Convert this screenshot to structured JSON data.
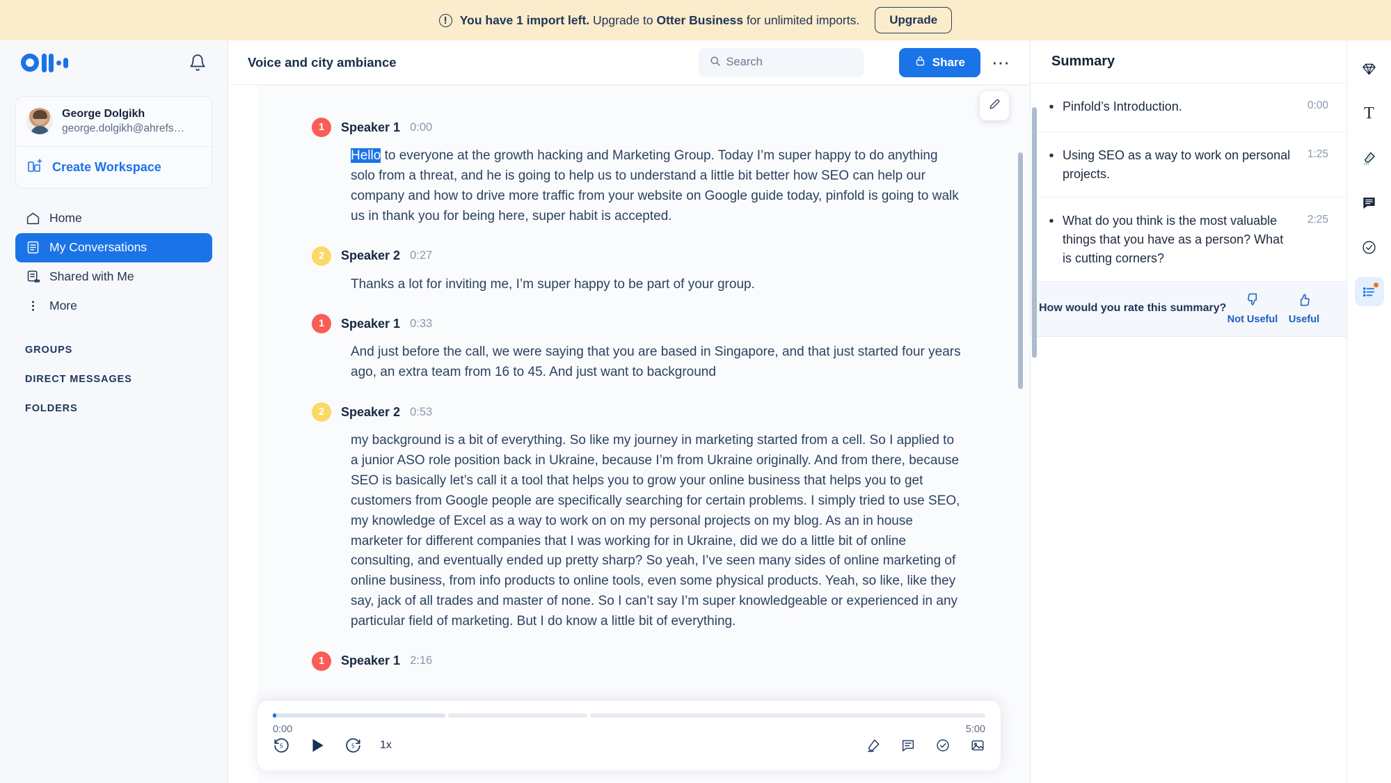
{
  "banner": {
    "icon": "alert-circle-icon",
    "text_before": "You have 1 import left.",
    "text_mid": " Upgrade to ",
    "brand": "Otter Business",
    "text_after": " for unlimited imports.",
    "upgrade_label": "Upgrade"
  },
  "sidebar": {
    "logo": "otter-logo",
    "notification_icon": "bell-icon",
    "user": {
      "name": "George Dolgikh",
      "email": "george.dolgikh@ahrefs…"
    },
    "create_workspace_label": "Create Workspace",
    "nav": [
      {
        "label": "Home",
        "icon": "home-icon",
        "active": false
      },
      {
        "label": "My Conversations",
        "icon": "conversations-icon",
        "active": true
      },
      {
        "label": "Shared with Me",
        "icon": "shared-icon",
        "active": false
      },
      {
        "label": "More",
        "icon": "more-vertical-icon",
        "active": false
      }
    ],
    "sections": [
      {
        "label": "GROUPS"
      },
      {
        "label": "DIRECT MESSAGES"
      },
      {
        "label": "FOLDERS"
      }
    ]
  },
  "topbar": {
    "conversation_title": "Voice and city ambiance",
    "search_placeholder": "Search",
    "search_value": "",
    "search_icon": "search-icon",
    "share_label": "Share",
    "share_icon": "lock-icon",
    "more_label": "⋯"
  },
  "transcript": {
    "edit_icon": "pencil-icon",
    "blocks": [
      {
        "speaker": "Speaker 1",
        "time": "0:00",
        "badge": "1",
        "color": "#fa5d55",
        "highlight": "Hello",
        "text": " to everyone at the growth hacking and Marketing Group. Today I’m super happy to do anything solo from a threat, and he is going to help us to understand a little bit better how SEO can help our company and how to drive more traffic from your website on Google guide today, pinfold is going to walk us in thank you for being here, super habit is accepted."
      },
      {
        "speaker": "Speaker 2",
        "time": "0:27",
        "badge": "2",
        "color": "#fbd967",
        "highlight": "",
        "text": "Thanks a lot for inviting me, I’m super happy to be part of your group."
      },
      {
        "speaker": "Speaker 1",
        "time": "0:33",
        "badge": "1",
        "color": "#fa5d55",
        "highlight": "",
        "text": "And just before the call, we were saying that you are based in Singapore, and that just started four years ago, an extra team from 16 to 45. And just want to background"
      },
      {
        "speaker": "Speaker 2",
        "time": "0:53",
        "badge": "2",
        "color": "#fbd967",
        "highlight": "",
        "text": "my background is a bit of everything. So like my journey in marketing started from a cell. So I applied to a junior ASO role position back in Ukraine, because I’m from Ukraine originally. And from there, because SEO is basically let’s call it a tool that helps you to grow your online business that helps you to get customers from Google people are specifically searching for certain problems. I simply tried to use SEO, my knowledge of Excel as a way to work on on my personal projects on my blog. As an in house marketer for different companies that I was working for in Ukraine, did we do a little bit of online consulting, and eventually ended up pretty sharp? So yeah, I’ve seen many sides of online marketing of online business, from info products to online tools, even some physical products. Yeah, so like, like they say, jack of all trades and master of none. So I can’t say I’m super knowledgeable or experienced in any particular field of marketing. But I do know a little bit of everything."
      },
      {
        "speaker": "Speaker 1",
        "time": "2:16",
        "badge": "1",
        "color": "#fa5d55",
        "highlight": "",
        "text": ""
      }
    ]
  },
  "player": {
    "current_time": "0:00",
    "total_time": "5:00",
    "speed": "1x",
    "rewind_icon": "rewind-15-icon",
    "play_icon": "play-icon",
    "forward_icon": "forward-15-icon",
    "tools": [
      "highlight-icon",
      "comment-icon",
      "action-item-icon",
      "image-icon"
    ]
  },
  "summary": {
    "title": "Summary",
    "items": [
      {
        "text": "Pinfold’s Introduction.",
        "time": "0:00"
      },
      {
        "text": "Using SEO as a way to work on personal projects.",
        "time": "1:25"
      },
      {
        "text": "What do you think is the most valuable things that you have as a person? What is cutting corners?",
        "time": "2:25"
      }
    ],
    "rate_question": "How would you rate this summary?",
    "not_useful_label": "Not Useful",
    "useful_label": "Useful",
    "not_useful_icon": "thumbs-down-icon",
    "useful_icon": "thumbs-up-icon"
  },
  "rail": {
    "buttons": [
      {
        "icon": "diamond-icon",
        "active": false,
        "badge": false
      },
      {
        "icon": "text-icon",
        "active": false,
        "badge": false
      },
      {
        "icon": "highlighter-icon",
        "active": false,
        "badge": false
      },
      {
        "icon": "comment-icon",
        "active": false,
        "badge": false
      },
      {
        "icon": "check-circle-icon",
        "active": false,
        "badge": false
      },
      {
        "icon": "outline-list-icon",
        "active": true,
        "badge": true
      }
    ]
  },
  "colors": {
    "accent": "#1b73e8",
    "banner_bg": "#fbeccb",
    "speaker1": "#fa5d55",
    "speaker2": "#fbd967",
    "badge_dot": "#e8732a"
  }
}
